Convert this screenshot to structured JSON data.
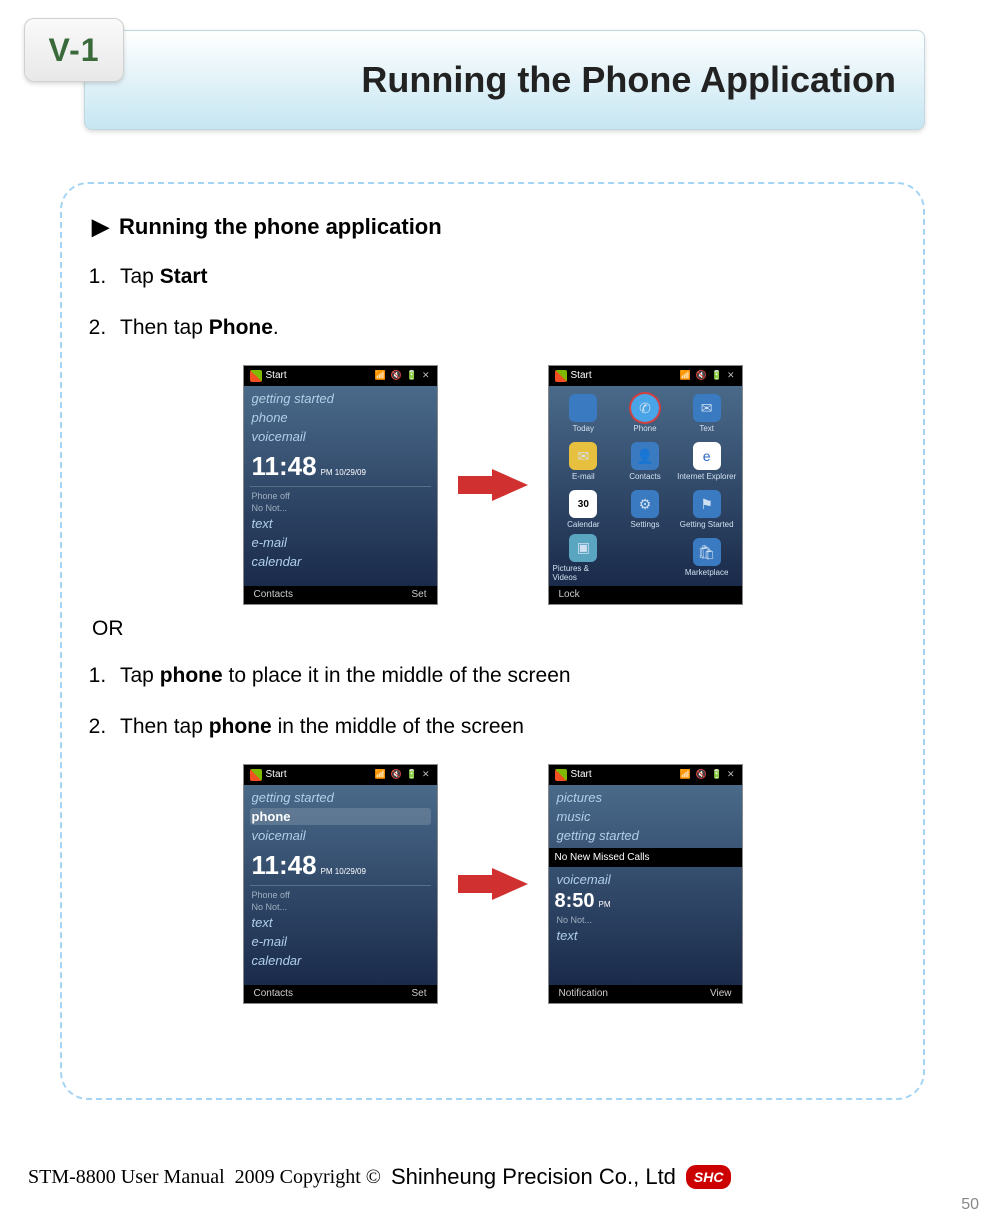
{
  "section_no": "V-1",
  "page_title": "Running the Phone Application",
  "sub_heading": "Running the phone application",
  "steps_a": [
    {
      "pre": "Tap ",
      "bold": "Start",
      "post": ""
    },
    {
      "pre": "Then tap ",
      "bold": "Phone",
      "post": "."
    }
  ],
  "or_text": "OR",
  "steps_b": [
    {
      "pre": "Tap ",
      "bold": "phone",
      "post": " to place it in the middle of the screen"
    },
    {
      "pre": "Then tap ",
      "bold": "phone",
      "post": " in the middle of the screen"
    }
  ],
  "screens": {
    "home1": {
      "top_label": "Start",
      "items": [
        "getting started",
        "phone",
        "voicemail"
      ],
      "time": "11:48",
      "time_sub": "PM\n10/29/09",
      "phone_off": "Phone off",
      "below": [
        "text",
        "e-mail",
        "calendar"
      ],
      "bottom_left": "Contacts",
      "bottom_right": "Set",
      "no_not": "No Not..."
    },
    "apps": {
      "top_label": "Start",
      "cells": [
        {
          "label": "Today",
          "cls": "blue",
          "glyph": ""
        },
        {
          "label": "Phone",
          "cls": "phone",
          "glyph": "✆"
        },
        {
          "label": "Text",
          "cls": "blue",
          "glyph": "✉"
        },
        {
          "label": "E-mail",
          "cls": "mail",
          "glyph": "✉"
        },
        {
          "label": "Contacts",
          "cls": "blue",
          "glyph": "👤"
        },
        {
          "label": "Internet Explorer",
          "cls": "ie",
          "glyph": "e"
        },
        {
          "label": "Calendar",
          "cls": "cal",
          "glyph": "30"
        },
        {
          "label": "Settings",
          "cls": "blue",
          "glyph": "⚙"
        },
        {
          "label": "Getting Started",
          "cls": "blue",
          "glyph": "⚑"
        },
        {
          "label": "Pictures & Videos",
          "cls": "pic",
          "glyph": "▣"
        },
        {
          "label": "",
          "cls": "",
          "glyph": ""
        },
        {
          "label": "Marketplace",
          "cls": "blue",
          "glyph": "🛍"
        }
      ],
      "bottom_left": "Lock",
      "bottom_right": ""
    },
    "home2_sel": {
      "top_label": "Start",
      "items": [
        "getting started",
        "phone",
        "voicemail"
      ],
      "selected": "phone",
      "time": "11:48",
      "time_sub": "PM\n10/29/09",
      "phone_off": "Phone off",
      "below": [
        "text",
        "e-mail",
        "calendar"
      ],
      "bottom_left": "Contacts",
      "bottom_right": "Set",
      "no_not": "No Not..."
    },
    "home3": {
      "top_label": "Start",
      "items_top": [
        "pictures",
        "music",
        "getting started"
      ],
      "banner": "No New Missed Calls",
      "items_bottom": [
        "voicemail"
      ],
      "time": "8:50",
      "time_sub": "PM",
      "below": [
        "text"
      ],
      "bottom_left": "Notification",
      "bottom_right": "View",
      "no_not": "No Not..."
    }
  },
  "footer": {
    "manual": "STM-8800 User Manual",
    "copyright": "2009 Copyright ©",
    "company": "Shinheung Precision Co., Ltd",
    "logo": "SHC"
  },
  "page_number": "50"
}
